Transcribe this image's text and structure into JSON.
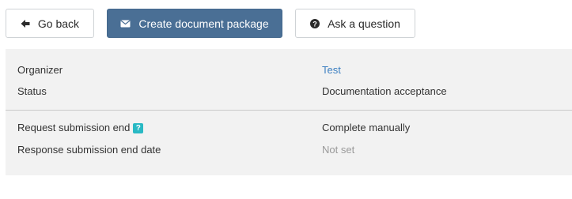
{
  "toolbar": {
    "back_label": "Go back",
    "create_label": "Create document package",
    "ask_label": "Ask a question"
  },
  "details": {
    "organizer_label": "Organizer",
    "organizer_value": "Test",
    "status_label": "Status",
    "status_value": "Documentation acceptance",
    "request_end_label": "Request submission end",
    "request_end_help": "?",
    "request_end_value": "Complete manually",
    "response_end_label": "Response submission end date",
    "response_end_value": "Not set"
  },
  "colors": {
    "primary": "#4a6f95",
    "link": "#3c7fc1",
    "help_badge": "#29b9c4",
    "muted": "#9a9a9a",
    "panel_bg": "#f2f2f2"
  },
  "icons": {
    "back": "arrow-left-icon",
    "create": "envelope-icon",
    "ask": "question-circle-icon"
  }
}
